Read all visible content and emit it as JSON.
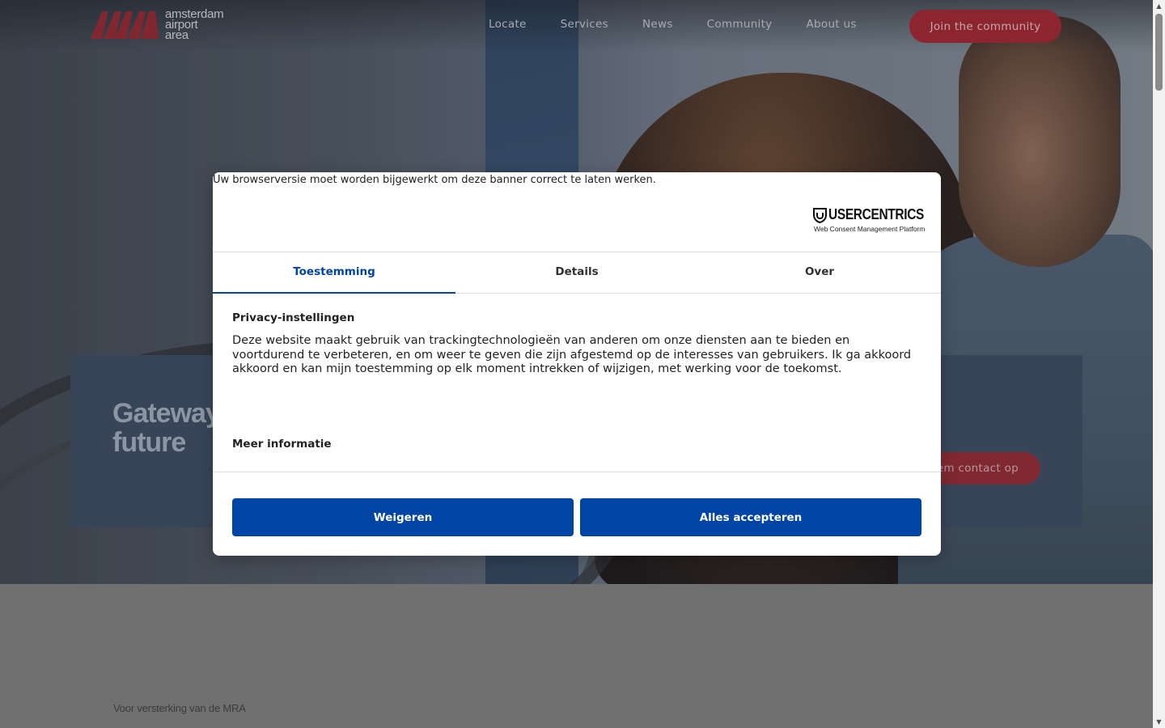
{
  "site": {
    "logo_lines": [
      "amsterdam",
      "airport",
      "area"
    ],
    "nav": [
      "Locate",
      "Services",
      "News",
      "Community",
      "About us"
    ],
    "join_label": "Join the community",
    "hero_title": "Gateway to a better future",
    "contact_label": "Neem contact op",
    "kicker": "Voor versterking van de MRA"
  },
  "consent": {
    "browser_warning": "Uw browserversie moet worden bijgewerkt om deze banner correct te laten werken.",
    "brand": "USERCENTRICS",
    "brand_sub": "Web Consent Management Platform",
    "tabs": [
      {
        "label": "Toestemming",
        "active": true
      },
      {
        "label": "Details",
        "active": false
      },
      {
        "label": "Over",
        "active": false
      }
    ],
    "section_title": "Privacy-instellingen",
    "description": "Deze website maakt gebruik van trackingtechnologieën van anderen om onze diensten aan te bieden en voortdurend te verbeteren, en om weer te geven die zijn afgestemd op de interesses van gebruikers. Ik ga akkoord akkoord en kan mijn toestemming op elk moment intrekken of wijzigen, met werking voor de toekomst.",
    "more_info": "Meer informatie",
    "deny_label": "Weigeren",
    "accept_label": "Alles accepteren"
  },
  "colors": {
    "consent_blue": "#0045a5",
    "brand_red": "#9b2530"
  }
}
